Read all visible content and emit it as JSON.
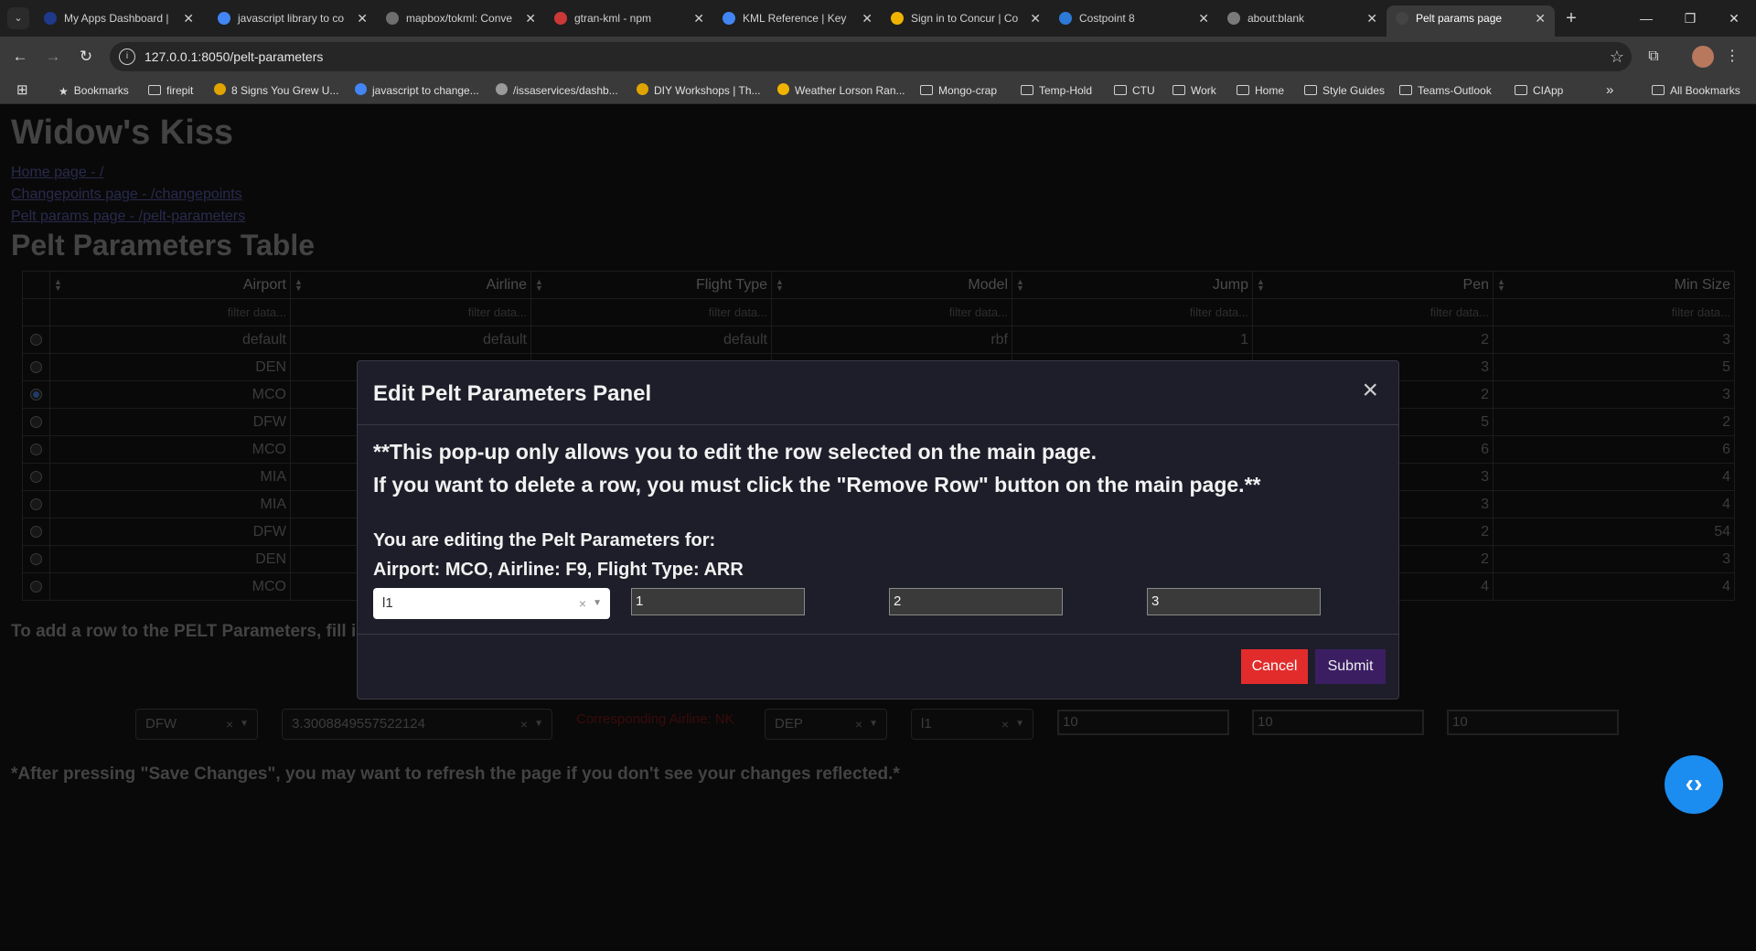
{
  "browser": {
    "tabs": [
      {
        "title": "My Apps Dashboard |",
        "favicon_color": "#1f3a8a"
      },
      {
        "title": "javascript library to co",
        "favicon_color": "#4285f4"
      },
      {
        "title": "mapbox/tokml: Conve",
        "favicon_color": "#6e6e6e"
      },
      {
        "title": "gtran-kml - npm",
        "favicon_color": "#cb3837"
      },
      {
        "title": "KML Reference  |  Key",
        "favicon_color": "#4285f4"
      },
      {
        "title": "Sign in to Concur | Co",
        "favicon_color": "#f0b400"
      },
      {
        "title": "Costpoint 8",
        "favicon_color": "#2d7ad6"
      },
      {
        "title": "about:blank",
        "favicon_color": "#7a7a7a"
      },
      {
        "title": "Pelt params page",
        "favicon_color": "#444444"
      }
    ],
    "url": "127.0.0.1:8050/pelt-parameters",
    "bookmarks": [
      {
        "label": "Bookmarks",
        "icon": "star-icon"
      },
      {
        "label": "firepit",
        "icon": "folder-icon"
      },
      {
        "label": "8 Signs You Grew U...",
        "icon": "site-icon"
      },
      {
        "label": "javascript to change...",
        "icon": "google-icon"
      },
      {
        "label": "/issaservices/dashb...",
        "icon": "globe-icon"
      },
      {
        "label": "DIY Workshops | Th...",
        "icon": "site-icon"
      },
      {
        "label": "Weather Lorson Ran...",
        "icon": "weather-icon"
      },
      {
        "label": "Mongo-crap",
        "icon": "folder-icon"
      },
      {
        "label": "Temp-Hold",
        "icon": "folder-icon"
      },
      {
        "label": "CTU",
        "icon": "folder-icon"
      },
      {
        "label": "Work",
        "icon": "folder-icon"
      },
      {
        "label": "Home",
        "icon": "folder-icon"
      },
      {
        "label": "Style Guides",
        "icon": "folder-icon"
      },
      {
        "label": "Teams-Outlook",
        "icon": "folder-icon"
      },
      {
        "label": "CIApp",
        "icon": "folder-icon"
      }
    ],
    "all_bookmarks": "All Bookmarks"
  },
  "page": {
    "title": "Widow's Kiss",
    "links": [
      "Home page - /",
      "Changepoints page - /changepoints",
      "Pelt params page - /pelt-parameters"
    ],
    "table_title": "Pelt Parameters Table",
    "columns": [
      "Airport",
      "Airline",
      "Flight Type",
      "Model",
      "Jump",
      "Pen",
      "Min Size"
    ],
    "filter_placeholder": "filter data...",
    "rows": [
      {
        "selected": false,
        "cells": [
          "default",
          "default",
          "default",
          "rbf",
          "1",
          "2",
          "3"
        ]
      },
      {
        "selected": false,
        "cells": [
          "DEN",
          "",
          "",
          "",
          "",
          "3",
          "5"
        ]
      },
      {
        "selected": true,
        "cells": [
          "MCO",
          "",
          "",
          "",
          "",
          "2",
          "3"
        ]
      },
      {
        "selected": false,
        "cells": [
          "DFW",
          "",
          "",
          "",
          "",
          "5",
          "2"
        ]
      },
      {
        "selected": false,
        "cells": [
          "MCO",
          "",
          "",
          "",
          "",
          "6",
          "6"
        ]
      },
      {
        "selected": false,
        "cells": [
          "MIA",
          "",
          "",
          "",
          "",
          "3",
          "4"
        ]
      },
      {
        "selected": false,
        "cells": [
          "MIA",
          "",
          "",
          "",
          "",
          "3",
          "4"
        ]
      },
      {
        "selected": false,
        "cells": [
          "DFW",
          "",
          "",
          "",
          "",
          "2",
          "54"
        ]
      },
      {
        "selected": false,
        "cells": [
          "DEN",
          "",
          "",
          "",
          "",
          "2",
          "3"
        ]
      },
      {
        "selected": false,
        "cells": [
          "MCO",
          "",
          "",
          "",
          "",
          "4",
          "4"
        ]
      }
    ],
    "add_note": "To add a row to the PELT Parameters, fill in",
    "add_form": {
      "airport": "DFW",
      "airline": "3.3008849557522124",
      "corresponding_airline": "Corresponding Airline: NK",
      "flight_type": "DEP",
      "model": "l1",
      "jump": "10",
      "pen": "10",
      "min_size": "10"
    },
    "save_note": "*After pressing \"Save Changes\", you may want to refresh the page if you don't see your changes reflected.*"
  },
  "modal": {
    "title": "Edit Pelt Parameters Panel",
    "close_label": "×",
    "warning_line1": "**This pop-up only allows you to edit the row selected on the main page.",
    "warning_line2": "If you want to delete a row, you must click the \"Remove Row\" button on the main page.**",
    "editing_label": "You are editing the Pelt Parameters for:",
    "editing_target": "Airport: MCO, Airline: F9, Flight Type: ARR",
    "model_value": "l1",
    "jump_value": "1",
    "pen_value": "2",
    "min_size_value": "3",
    "cancel_label": "Cancel",
    "submit_label": "Submit"
  },
  "colors": {
    "link": "#4c4d8d",
    "cancel": "#e22c2c",
    "submit": "#3b1e62",
    "fab": "#1b8df0"
  }
}
